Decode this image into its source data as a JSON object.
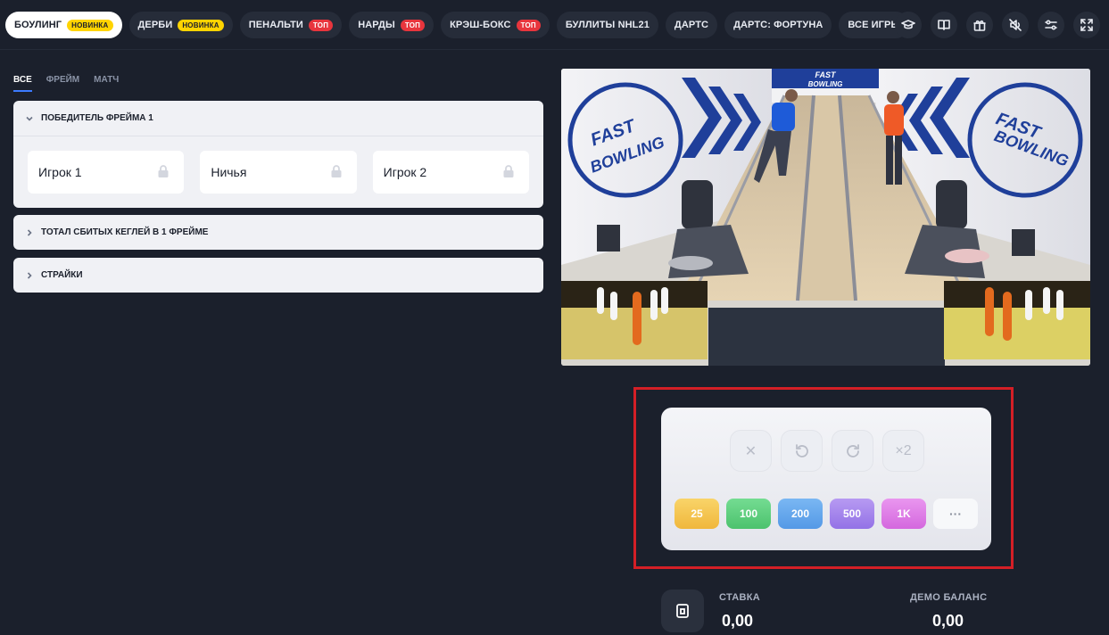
{
  "nav": {
    "tabs": [
      {
        "label": "БОУЛИНГ",
        "badge": "НОВИНКА",
        "badge_type": "new",
        "active": true
      },
      {
        "label": "ДЕРБИ",
        "badge": "НОВИНКА",
        "badge_type": "new",
        "active": false
      },
      {
        "label": "ПЕНАЛЬТИ",
        "badge": "ТОП",
        "badge_type": "top",
        "active": false
      },
      {
        "label": "НАРДЫ",
        "badge": "ТОП",
        "badge_type": "top",
        "active": false
      },
      {
        "label": "КРЭШ-БОКС",
        "badge": "ТОП",
        "badge_type": "top",
        "active": false
      },
      {
        "label": "БУЛЛИТЫ NHL21",
        "badge": "",
        "badge_type": "",
        "active": false
      },
      {
        "label": "ДАРТС",
        "badge": "",
        "badge_type": "",
        "active": false
      },
      {
        "label": "ДАРТС: ФОРТУНА",
        "badge": "",
        "badge_type": "",
        "active": false
      },
      {
        "label": "ВСЕ ИГРЫ",
        "badge": "",
        "badge_type": "",
        "active": false
      }
    ],
    "tools": [
      "graduation-cap-icon",
      "book-icon",
      "gift-icon",
      "sound-off-icon",
      "settings-sliders-icon",
      "fullscreen-icon"
    ]
  },
  "markets": {
    "subtabs": [
      {
        "label": "ВСЕ",
        "active": true
      },
      {
        "label": "ФРЕЙМ",
        "active": false
      },
      {
        "label": "МАТЧ",
        "active": false
      }
    ],
    "frame_winner": {
      "title": "ПОБЕДИТЕЛЬ ФРЕЙМА 1",
      "outcomes": [
        "Игрок 1",
        "Ничья",
        "Игрок 2"
      ]
    },
    "total_pins": {
      "title": "ТОТАЛ СБИТЫХ КЕГЛЕЙ В 1 ФРЕЙМЕ"
    },
    "strikes": {
      "title": "СТРАЙКИ"
    }
  },
  "video": {
    "brand_top_line1": "FAST",
    "brand_top_line2": "BOWLING",
    "brand_side_line1": "FAST",
    "brand_side_line2": "BOWLING"
  },
  "bet": {
    "controls": {
      "clear": "✕",
      "undo": "undo-icon",
      "redo": "redo-icon",
      "double": "×2"
    },
    "chips": [
      {
        "label": "25",
        "color": "#f6c34a"
      },
      {
        "label": "100",
        "color": "#5ccf7c"
      },
      {
        "label": "200",
        "color": "#62a7ee"
      },
      {
        "label": "500",
        "color": "#a383ec"
      },
      {
        "label": "1K",
        "color": "#dd7ae6"
      },
      {
        "label": "···",
        "color": "#f4f5f8"
      }
    ]
  },
  "stats": {
    "stake_label": "СТАВКА",
    "stake_value": "0,00",
    "balance_label": "ДЕМО БАЛАНС",
    "balance_value": "0,00"
  }
}
